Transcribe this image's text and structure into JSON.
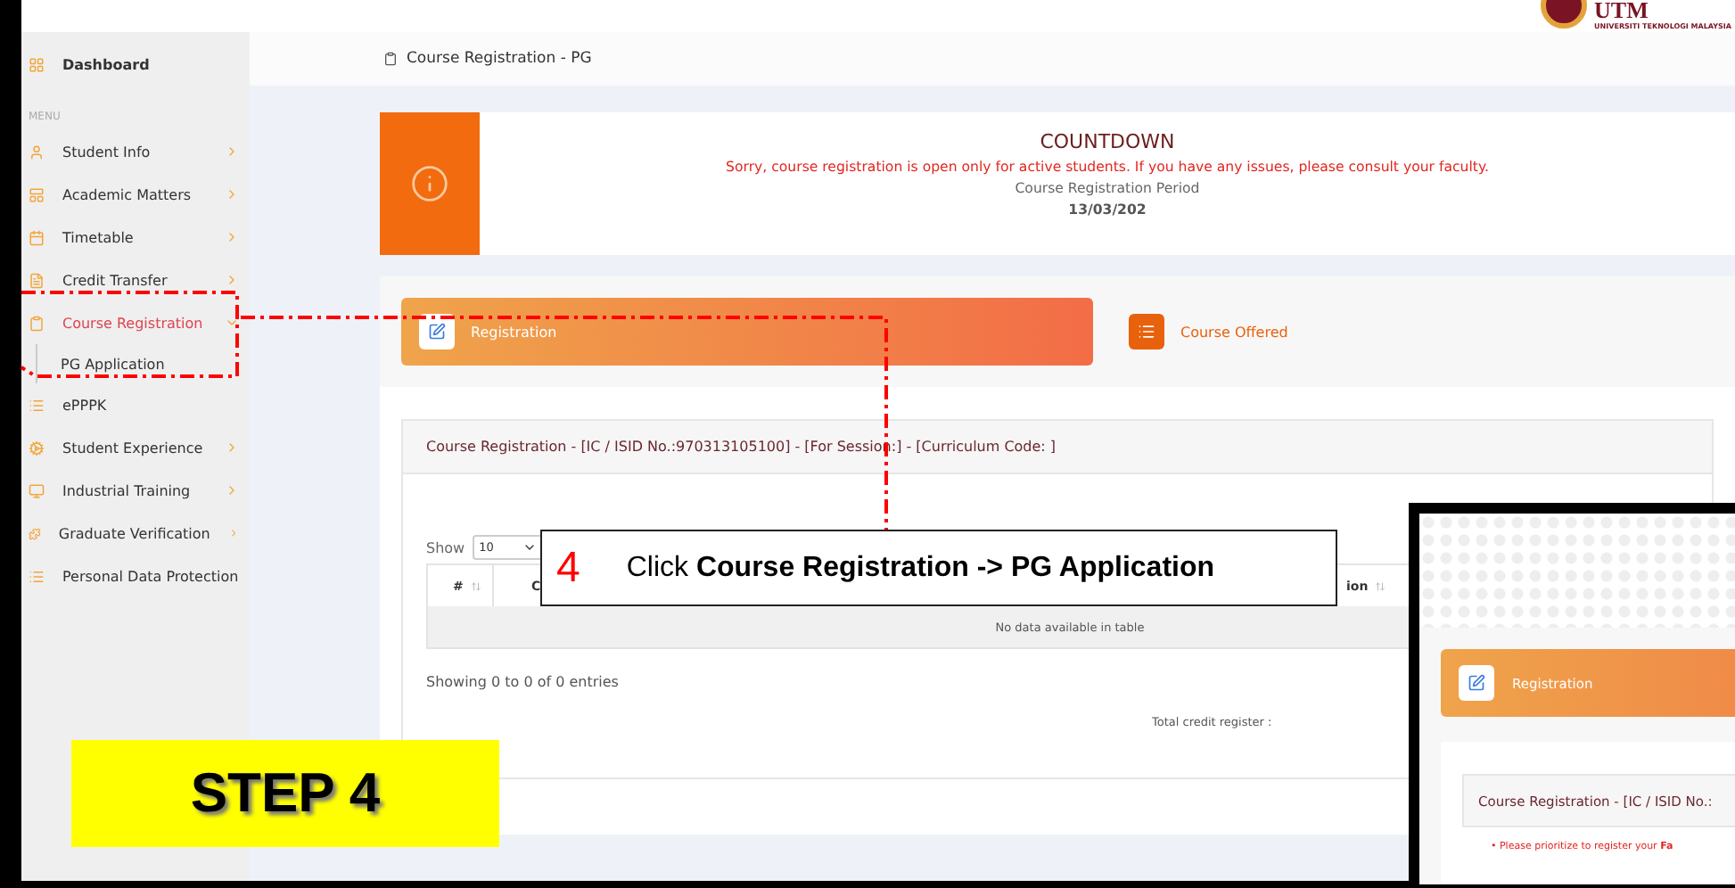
{
  "top_bar": {
    "logo_text": "UTM",
    "logo_caption": "UNIVERSITI TEKNOLOGI MALAYSIA"
  },
  "sidebar": {
    "dashboard": "Dashboard",
    "section_label": "MENU",
    "items": [
      {
        "label": "Student Info",
        "kind": "menu",
        "selected": false,
        "expanded": false
      },
      {
        "label": "Academic Matters",
        "kind": "menu",
        "selected": false,
        "expanded": false
      },
      {
        "label": "Timetable",
        "kind": "menu",
        "selected": false,
        "expanded": false
      },
      {
        "label": "Credit Transfer",
        "kind": "menu",
        "selected": false,
        "expanded": false
      },
      {
        "label": "Course Registration",
        "kind": "menu",
        "selected": true,
        "expanded": true,
        "children": [
          {
            "label": "PG Application"
          }
        ]
      },
      {
        "label": "ePPPK",
        "kind": "link",
        "selected": false
      },
      {
        "label": "Student Experience",
        "kind": "menu",
        "selected": false,
        "expanded": false
      },
      {
        "label": "Industrial Training",
        "kind": "menu",
        "selected": false,
        "expanded": false
      },
      {
        "label": "Graduate Verification",
        "kind": "menu",
        "selected": false,
        "expanded": false
      },
      {
        "label": "Personal Data Protection",
        "kind": "link",
        "selected": false
      }
    ]
  },
  "breadcrumb": "Course Registration - PG",
  "countdown": {
    "title": "COUNTDOWN",
    "message": "Sorry, course registration is open only for active students. If you have any issues, please consult your faculty.",
    "period_label": "Course Registration Period",
    "period_value": "13/03/202"
  },
  "tabs": [
    {
      "label": "Registration",
      "selected": true
    },
    {
      "label": "Course Offered",
      "selected": false
    }
  ],
  "card": {
    "title": "Course Registration - [IC / ISID No.:970313105100] - [For Session:] - [Curriculum Code: ]",
    "show_label": "Show",
    "page_size": "10",
    "columns": [
      "#",
      "C",
      "",
      "ion"
    ],
    "empty_message": "No data available in table",
    "entries_info": "Showing 0 to 0 of 0 entries",
    "total_label": "Total credit register :"
  },
  "callout": {
    "number": "4",
    "text": "Click **Course Registration -> PG Application**"
  },
  "step_label": "STEP 4",
  "inset": {
    "tab_label": "Registration",
    "title": "Course Registration - [IC / ISID No.:",
    "notice": "• Please prioritize to register your **Fa**"
  }
}
